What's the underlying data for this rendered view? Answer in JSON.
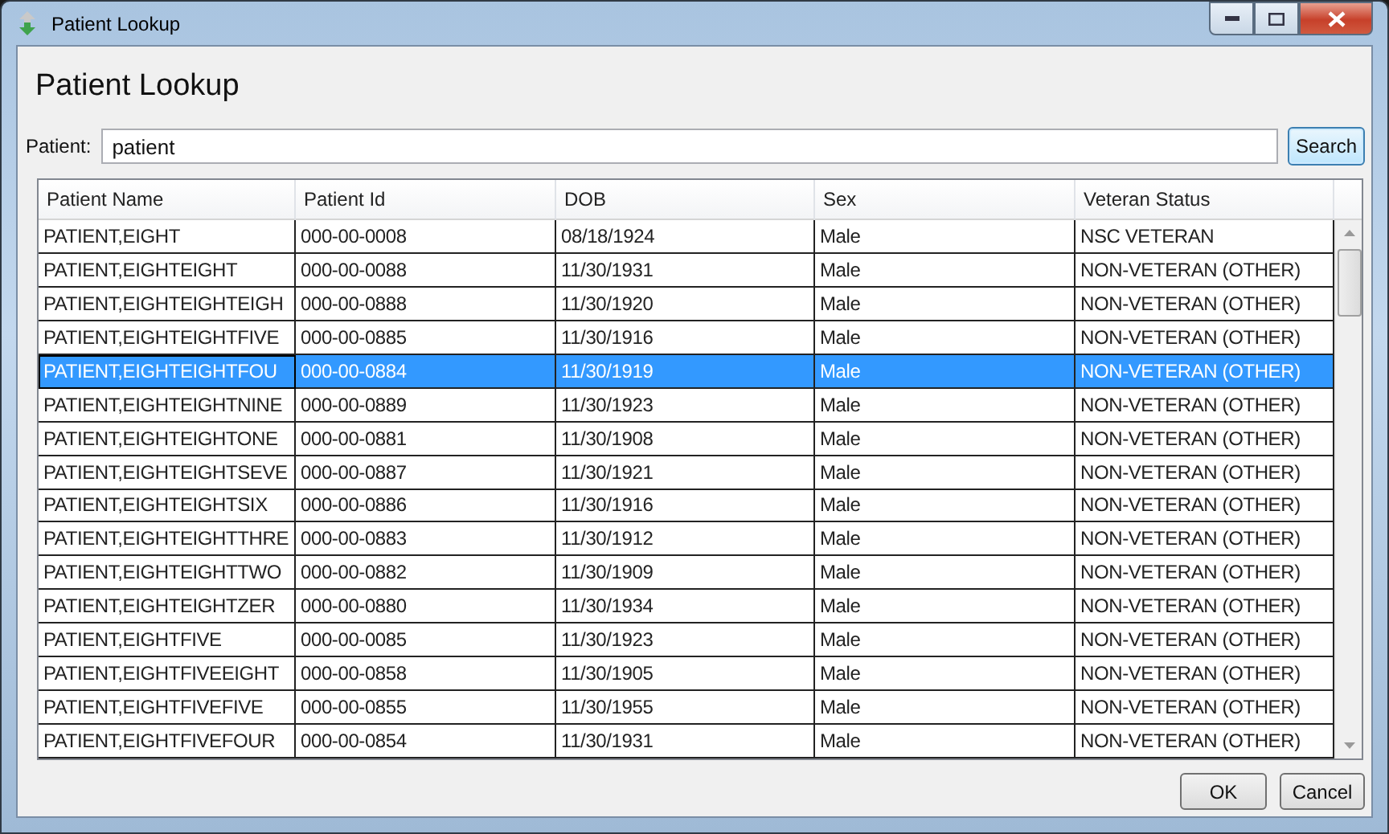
{
  "window": {
    "title": "Patient Lookup"
  },
  "heading": "Patient Lookup",
  "search": {
    "label": "Patient:",
    "value": "patient",
    "button": "Search"
  },
  "table": {
    "columns": [
      "Patient Name",
      "Patient Id",
      "DOB",
      "Sex",
      "Veteran Status"
    ],
    "rows": [
      {
        "cells": [
          "PATIENT,EIGHT",
          "000-00-0008",
          "08/18/1924",
          "Male",
          "NSC VETERAN"
        ],
        "selected": false
      },
      {
        "cells": [
          "PATIENT,EIGHTEIGHT",
          "000-00-0088",
          "11/30/1931",
          "Male",
          "NON-VETERAN (OTHER)"
        ],
        "selected": false
      },
      {
        "cells": [
          "PATIENT,EIGHTEIGHTEIGH",
          "000-00-0888",
          "11/30/1920",
          "Male",
          "NON-VETERAN (OTHER)"
        ],
        "selected": false
      },
      {
        "cells": [
          "PATIENT,EIGHTEIGHTFIVE",
          "000-00-0885",
          "11/30/1916",
          "Male",
          "NON-VETERAN (OTHER)"
        ],
        "selected": false
      },
      {
        "cells": [
          "PATIENT,EIGHTEIGHTFOU",
          "000-00-0884",
          "11/30/1919",
          "Male",
          "NON-VETERAN (OTHER)"
        ],
        "selected": true
      },
      {
        "cells": [
          "PATIENT,EIGHTEIGHTNINE",
          "000-00-0889",
          "11/30/1923",
          "Male",
          "NON-VETERAN (OTHER)"
        ],
        "selected": false
      },
      {
        "cells": [
          "PATIENT,EIGHTEIGHTONE",
          "000-00-0881",
          "11/30/1908",
          "Male",
          "NON-VETERAN (OTHER)"
        ],
        "selected": false
      },
      {
        "cells": [
          "PATIENT,EIGHTEIGHTSEVE",
          "000-00-0887",
          "11/30/1921",
          "Male",
          "NON-VETERAN (OTHER)"
        ],
        "selected": false
      },
      {
        "cells": [
          "PATIENT,EIGHTEIGHTSIX",
          "000-00-0886",
          "11/30/1916",
          "Male",
          "NON-VETERAN (OTHER)"
        ],
        "selected": false
      },
      {
        "cells": [
          "PATIENT,EIGHTEIGHTTHRE",
          "000-00-0883",
          "11/30/1912",
          "Male",
          "NON-VETERAN (OTHER)"
        ],
        "selected": false
      },
      {
        "cells": [
          "PATIENT,EIGHTEIGHTTWO",
          "000-00-0882",
          "11/30/1909",
          "Male",
          "NON-VETERAN (OTHER)"
        ],
        "selected": false
      },
      {
        "cells": [
          "PATIENT,EIGHTEIGHTZER",
          "000-00-0880",
          "11/30/1934",
          "Male",
          "NON-VETERAN (OTHER)"
        ],
        "selected": false
      },
      {
        "cells": [
          "PATIENT,EIGHTFIVE",
          "000-00-0085",
          "11/30/1923",
          "Male",
          "NON-VETERAN (OTHER)"
        ],
        "selected": false
      },
      {
        "cells": [
          "PATIENT,EIGHTFIVEEIGHT",
          "000-00-0858",
          "11/30/1905",
          "Male",
          "NON-VETERAN (OTHER)"
        ],
        "selected": false
      },
      {
        "cells": [
          "PATIENT,EIGHTFIVEFIVE",
          "000-00-0855",
          "11/30/1955",
          "Male",
          "NON-VETERAN (OTHER)"
        ],
        "selected": false
      },
      {
        "cells": [
          "PATIENT,EIGHTFIVEFOUR",
          "000-00-0854",
          "11/30/1931",
          "Male",
          "NON-VETERAN (OTHER)"
        ],
        "selected": false
      }
    ]
  },
  "buttons": [
    "OK",
    "Cancel"
  ]
}
